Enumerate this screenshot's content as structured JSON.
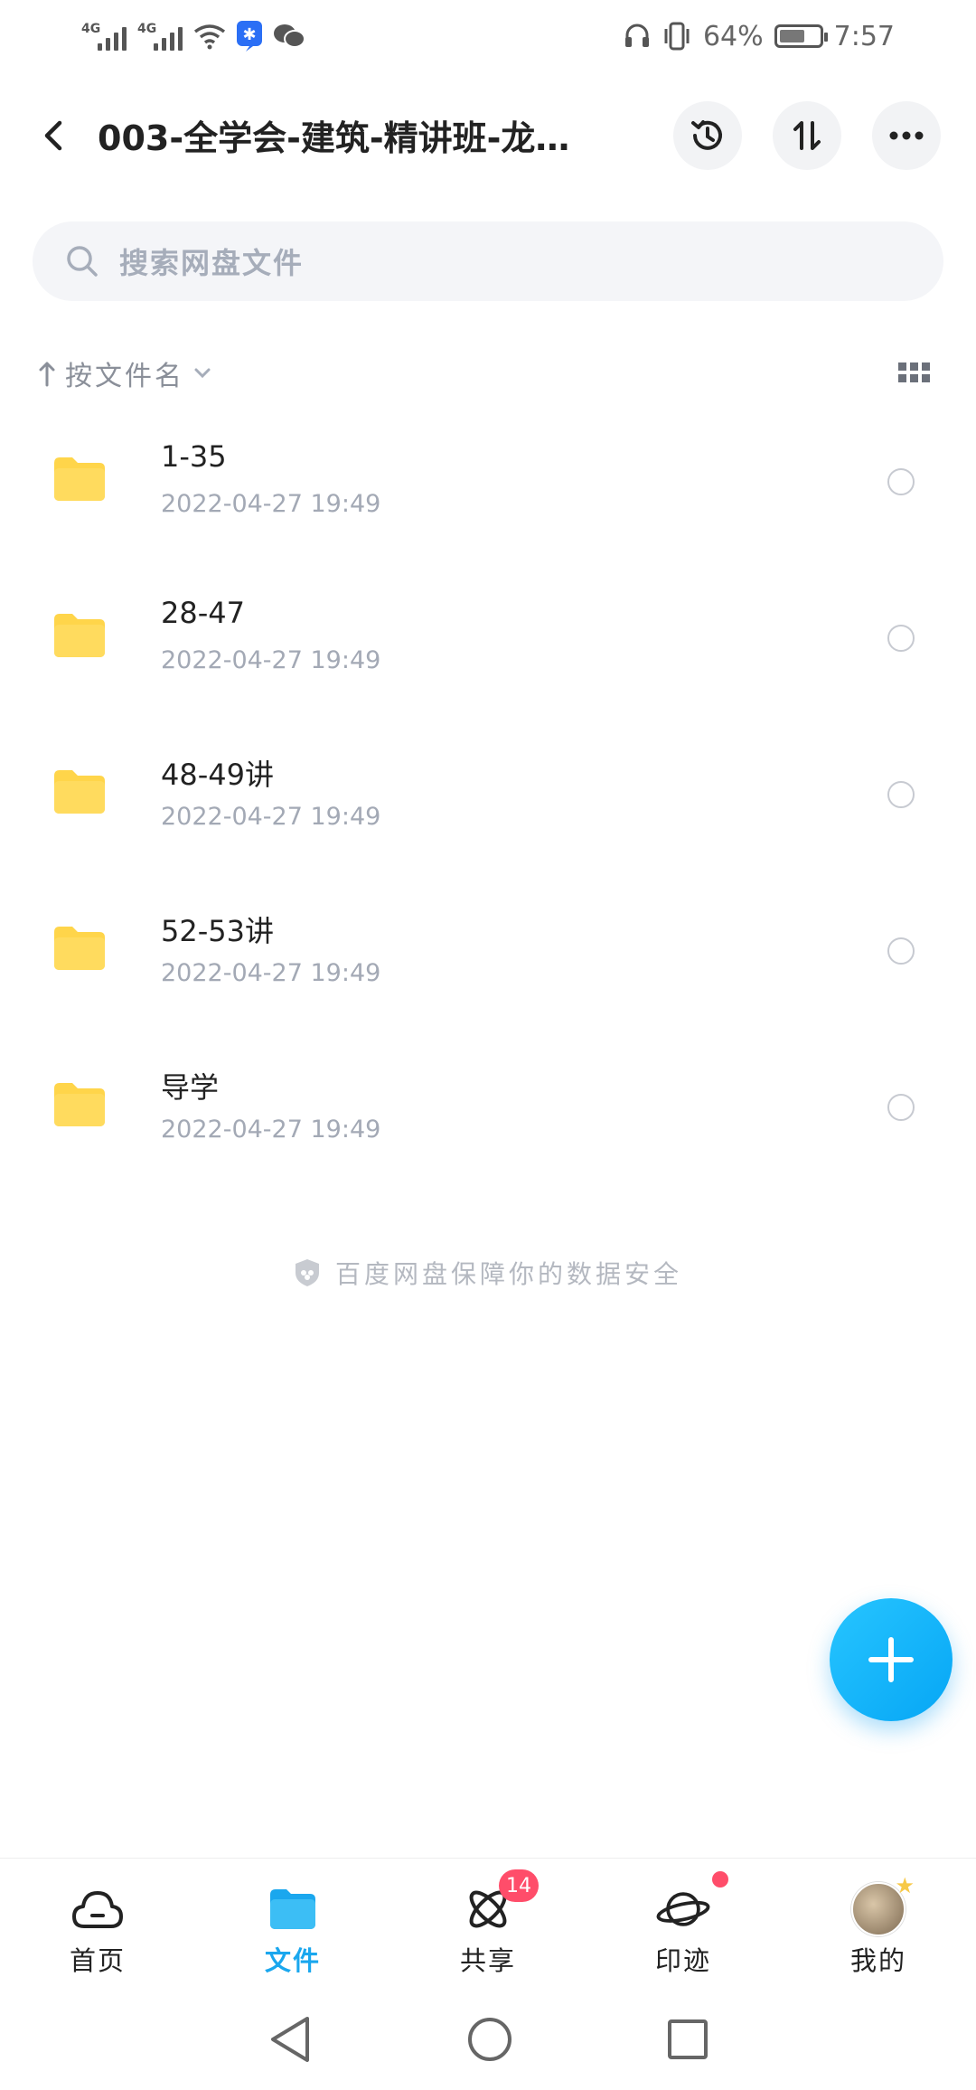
{
  "status_bar": {
    "net1": "4G",
    "net2": "4G",
    "battery": "64%",
    "time": "7:57",
    "battery_level": 0.64
  },
  "header": {
    "title": "003-全学会-建筑-精讲班-龙…",
    "icons": [
      "back-icon",
      "history-icon",
      "transfer-icon",
      "more-icon"
    ]
  },
  "search": {
    "placeholder": "搜索网盘文件"
  },
  "sort": {
    "label": "按文件名"
  },
  "files": [
    {
      "name": "1-35",
      "date": "2022-04-27  19:49"
    },
    {
      "name": "28-47",
      "date": "2022-04-27  19:49"
    },
    {
      "name": "48-49讲",
      "date": "2022-04-27  19:49"
    },
    {
      "name": "52-53讲",
      "date": "2022-04-27  19:49"
    },
    {
      "name": "导学",
      "date": "2022-04-27  19:49"
    }
  ],
  "safety_text": "百度网盘保障你的数据安全",
  "tabs": [
    {
      "label": "首页",
      "icon": "cloud-icon"
    },
    {
      "label": "文件",
      "icon": "folder-icon",
      "active": true
    },
    {
      "label": "共享",
      "icon": "share-atom-icon",
      "badge": "14"
    },
    {
      "label": "印迹",
      "icon": "planet-icon",
      "dot": true
    },
    {
      "label": "我的",
      "icon": "avatar"
    }
  ],
  "colors": {
    "accent": "#1aa7ee",
    "folder": "#ffd54a",
    "badge": "#ff4d6a"
  }
}
